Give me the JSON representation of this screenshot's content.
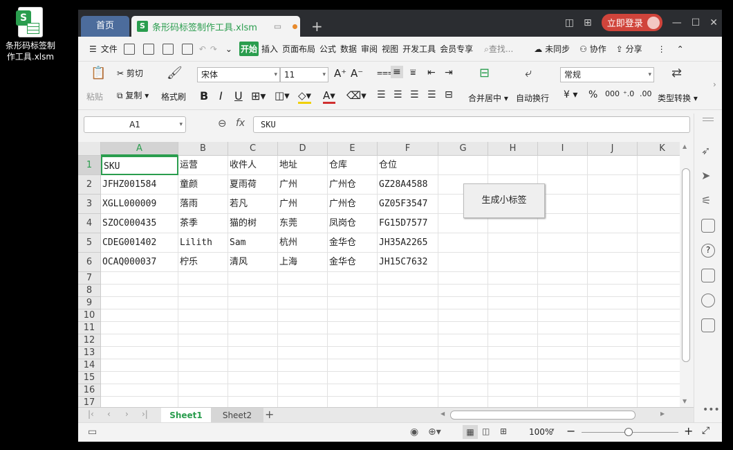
{
  "desktop": {
    "file_label_line1": "条形码标签制",
    "file_label_line2": "作工具.xlsm"
  },
  "titlebar": {
    "home_tab": "首页",
    "doc_tab": "条形码标签制作工具.xlsm",
    "login_button": "立即登录"
  },
  "menu": {
    "file": "文件",
    "tabs": [
      "开始",
      "插入",
      "页面布局",
      "公式",
      "数据",
      "审阅",
      "视图",
      "开发工具",
      "会员专享"
    ],
    "search_placeholder": "查找...",
    "sync": "未同步",
    "collab": "协作",
    "share": "分享"
  },
  "ribbon": {
    "paste": "粘贴",
    "cut": "剪切",
    "copy": "复制",
    "format_painter": "格式刷",
    "font_name": "宋体",
    "font_size": "11",
    "merge_center": "合并居中",
    "wrap_text": "自动换行",
    "number_format": "常规",
    "type_convert": "类型转换"
  },
  "formula_bar": {
    "cell_ref": "A1",
    "fx": "fx",
    "content": "SKU"
  },
  "sheet": {
    "columns": [
      "A",
      "B",
      "C",
      "D",
      "E",
      "F",
      "G",
      "H",
      "I",
      "J",
      "K"
    ],
    "row_numbers": [
      "1",
      "2",
      "3",
      "4",
      "5",
      "6",
      "7",
      "8",
      "9",
      "10",
      "11",
      "12",
      "13",
      "14",
      "15",
      "16",
      "17"
    ],
    "rows": [
      [
        "SKU",
        "运营",
        "收件人",
        "地址",
        "仓库",
        "仓位"
      ],
      [
        "JFHZ001584",
        "童颜",
        "夏雨荷",
        "广州",
        "广州仓",
        "GZ28A4588"
      ],
      [
        "XGLL000009",
        "落雨",
        "若凡",
        "广州",
        "广州仓",
        "GZ05F3547"
      ],
      [
        "SZOC000435",
        "茶季",
        "猫的树",
        "东莞",
        "凤岗仓",
        "FG15D7577"
      ],
      [
        "CDEG001402",
        "Lilith",
        "Sam",
        "杭州",
        "金华仓",
        "JH35A2265"
      ],
      [
        "OCAQ000037",
        "柠乐",
        "清风",
        "上海",
        "金华仓",
        "JH15C7632"
      ]
    ],
    "macro_button": "生成小标签"
  },
  "sheet_tabs": [
    "Sheet1",
    "Sheet2"
  ],
  "status": {
    "zoom": "100%"
  }
}
